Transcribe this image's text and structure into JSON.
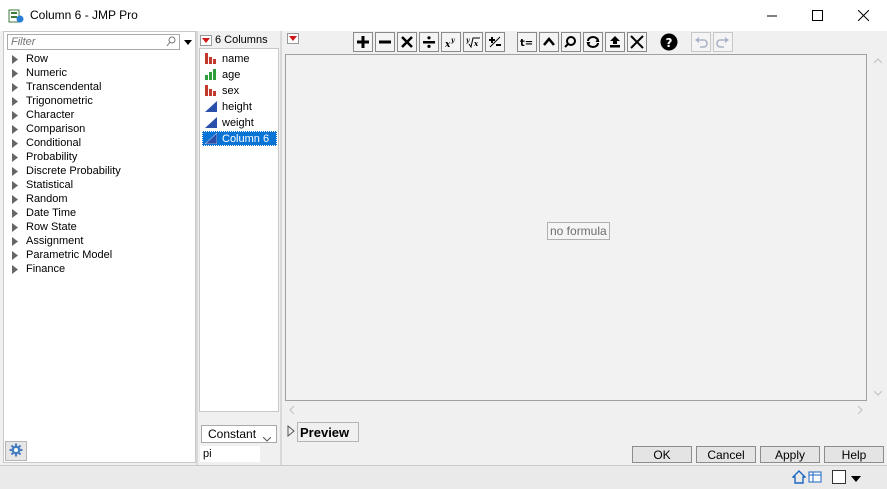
{
  "window": {
    "title": "Column 6 - JMP Pro",
    "controls": [
      "minimize-icon",
      "maximize-icon",
      "close-icon"
    ]
  },
  "functions": {
    "filter_placeholder": "Filter",
    "items": [
      "Row",
      "Numeric",
      "Transcendental",
      "Trigonometric",
      "Character",
      "Comparison",
      "Conditional",
      "Probability",
      "Discrete Probability",
      "Statistical",
      "Random",
      "Date Time",
      "Row State",
      "Assignment",
      "Parametric Model",
      "Finance"
    ]
  },
  "columns": {
    "header": "6 Columns",
    "items": [
      {
        "name": "name",
        "icon": "nominal-bar-icon",
        "color": "#c0392b"
      },
      {
        "name": "age",
        "icon": "ordinal-bar-icon",
        "color": "#2e9e3a"
      },
      {
        "name": "sex",
        "icon": "nominal-bar-icon",
        "color": "#c0392b"
      },
      {
        "name": "height",
        "icon": "continuous-triangle-icon",
        "color": "#2a4fa8"
      },
      {
        "name": "weight",
        "icon": "continuous-triangle-icon",
        "color": "#2a4fa8"
      },
      {
        "name": "Column 6",
        "icon": "continuous-triangle-icon",
        "color": "#2a4fa8"
      }
    ],
    "selected": "Column 6"
  },
  "source_select": {
    "value": "Constant"
  },
  "constant_input": {
    "value": "pi"
  },
  "toolbar": {
    "buttons": [
      "add-icon",
      "subtract-icon",
      "multiply-icon",
      "divide-icon",
      "power-icon",
      "root-icon",
      "plus-minus-icon",
      "assign-icon",
      "peel-icon",
      "local-icon",
      "swap-icon",
      "unwrap-icon",
      "delete-icon",
      "help-icon",
      "undo-icon",
      "redo-icon"
    ]
  },
  "editor": {
    "empty_text": "no formula"
  },
  "preview": {
    "label": "Preview"
  },
  "dialog_buttons": {
    "ok": "OK",
    "cancel": "Cancel",
    "apply": "Apply",
    "help": "Help"
  },
  "colors": {
    "accent": "#0a74d5",
    "dropdown_red": "#d01818"
  }
}
